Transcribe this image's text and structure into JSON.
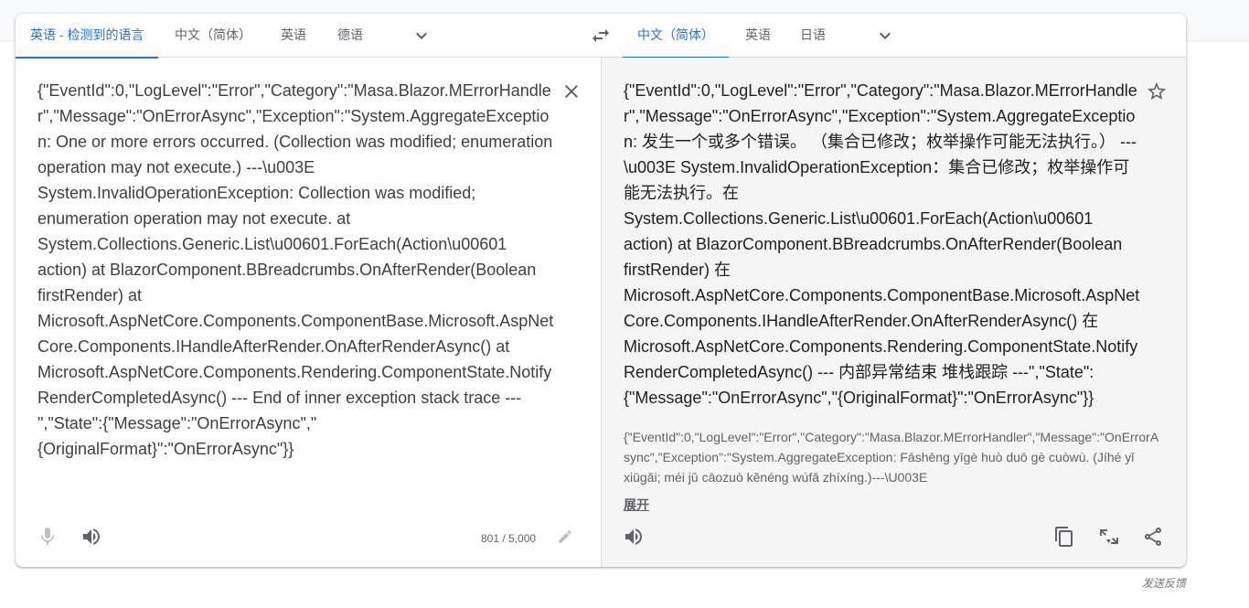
{
  "source_langs": {
    "tabs": [
      {
        "label": "英语 - 检测到的语言",
        "active": true
      },
      {
        "label": "中文（简体）",
        "active": false
      },
      {
        "label": "英语",
        "active": false
      },
      {
        "label": "德语",
        "active": false
      }
    ]
  },
  "target_langs": {
    "tabs": [
      {
        "label": "中文（简体）",
        "active": true
      },
      {
        "label": "英语",
        "active": false
      },
      {
        "label": "日语",
        "active": false
      }
    ]
  },
  "source": {
    "text": "{\"EventId\":0,\"LogLevel\":\"Error\",\"Category\":\"Masa.Blazor.MErrorHandler\",\"Message\":\"OnErrorAsync\",\"Exception\":\"System.AggregateException: One or more errors occurred. (Collection was modified; enumeration operation may not execute.) ---\\u003E System.InvalidOperationException: Collection was modified; enumeration operation may not execute. at System.Collections.Generic.List\\u00601.ForEach(Action\\u00601 action) at BlazorComponent.BBreadcrumbs.OnAfterRender(Boolean firstRender) at Microsoft.AspNetCore.Components.ComponentBase.Microsoft.AspNetCore.Components.IHandleAfterRender.OnAfterRenderAsync() at Microsoft.AspNetCore.Components.Rendering.ComponentState.NotifyRenderCompletedAsync() --- End of inner exception stack trace --- \",\"State\":{\"Message\":\"OnErrorAsync\",\"{OriginalFormat}\":\"OnErrorAsync\"}}",
    "char_count": "801 / 5,000"
  },
  "translation": {
    "text": "{\"EventId\":0,\"LogLevel\":\"Error\",\"Category\":\"Masa.Blazor.MErrorHandler\",\"Message\":\"OnErrorAsync\",\"Exception\":\"System.AggregateException: 发生一个或多个错误。 （集合已修改；枚举操作可能无法执行。） ---\\u003E System.InvalidOperationException：集合已修改；枚举操作可能无法执行。在 System.Collections.Generic.List\\u00601.ForEach(Action\\u00601 action) at BlazorComponent.BBreadcrumbs.OnAfterRender(Boolean firstRender) 在 Microsoft.AspNetCore.Components.ComponentBase.Microsoft.AspNetCore.Components.IHandleAfterRender.OnAfterRenderAsync() 在 Microsoft.AspNetCore.Components.Rendering.ComponentState.NotifyRenderCompletedAsync() --- 内部异常结束 堆栈跟踪 ---\",\"State\":{\"Message\":\"OnErrorAsync\",\"{OriginalFormat}\":\"OnErrorAsync\"}}",
    "transliteration": "{\"EventId\":0,\"LogLevel\":\"Error\",\"Category\":\"Masa.Blazor.MErrorHandler\",\"Message\":\"OnErrorAsync\",\"Exception\":\"System.AggregateException: Fāshēng yīgè huò duō gè cuòwù. (Jíhé yǐ xiūgǎi; méi jǔ cāozuò kěnéng wúfǎ zhíxíng.)---\\U003E",
    "expand_label": "展开"
  },
  "footer": {
    "feedback_label": "发送反馈"
  },
  "colors": {
    "accent": "#1a73e8",
    "icon": "#5f6368",
    "target_bg": "#f5f5f5"
  }
}
